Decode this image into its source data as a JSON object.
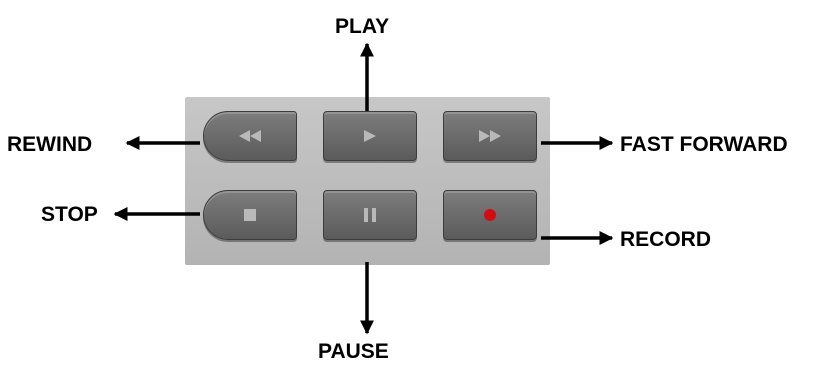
{
  "labels": {
    "play": "PLAY",
    "rewind": "REWIND",
    "fast_forward": "FAST FORWARD",
    "stop": "STOP",
    "record": "RECORD",
    "pause": "PAUSE"
  },
  "icons": {
    "rewind": "rewind-icon",
    "play": "play-icon",
    "fast_forward": "fast-forward-icon",
    "stop": "stop-icon",
    "pause": "pause-icon",
    "record": "record-icon"
  },
  "colors": {
    "record_dot": "#d10d12",
    "icon": "#b9b9b9"
  }
}
